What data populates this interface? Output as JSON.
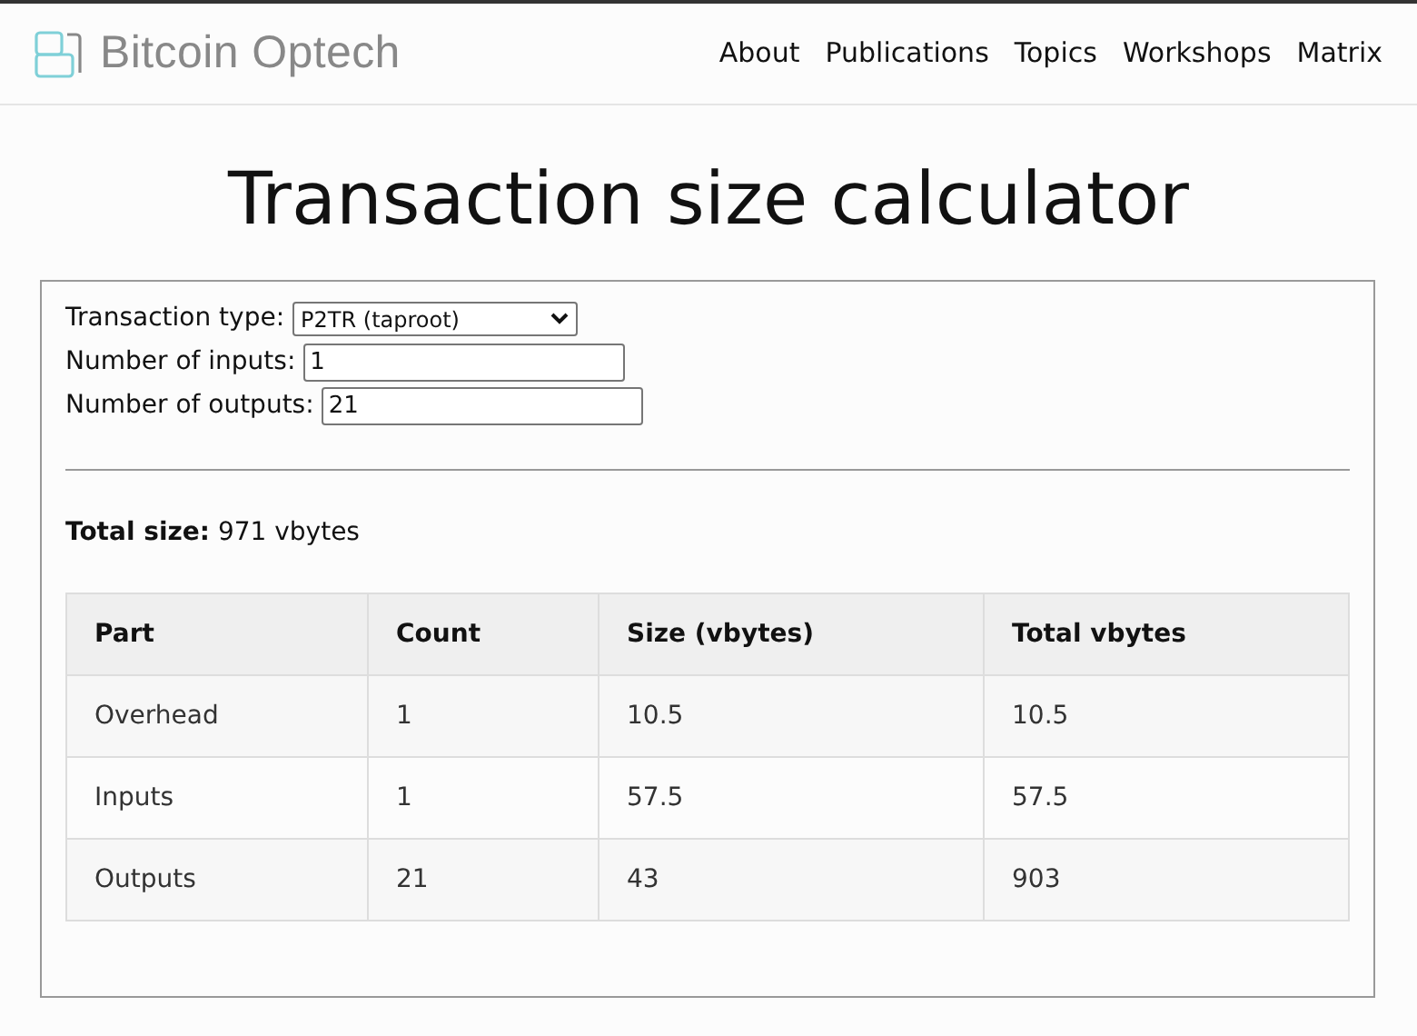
{
  "header": {
    "logo_text": "Bitcoin Optech",
    "nav": [
      "About",
      "Publications",
      "Topics",
      "Workshops",
      "Matrix"
    ]
  },
  "title": "Transaction size calculator",
  "form": {
    "fields": [
      {
        "kind": "select",
        "label": "Transaction type:",
        "value": "P2TR (taproot)"
      },
      {
        "kind": "input",
        "label": "Number of inputs:",
        "value": "1"
      },
      {
        "kind": "input",
        "label": "Number of outputs:",
        "value": "21"
      }
    ],
    "total": "**Total size:** 971 vbytes"
  },
  "table": {
    "columns": [
      "Part",
      "Count",
      "Size (vbytes)",
      "Total vbytes"
    ],
    "rows": [
      [
        "Overhead",
        "1",
        "10.5",
        "10.5"
      ],
      [
        "Inputs",
        "1",
        "57.5",
        "57.5"
      ],
      [
        "Outputs",
        "21",
        "43",
        "903"
      ]
    ]
  }
}
